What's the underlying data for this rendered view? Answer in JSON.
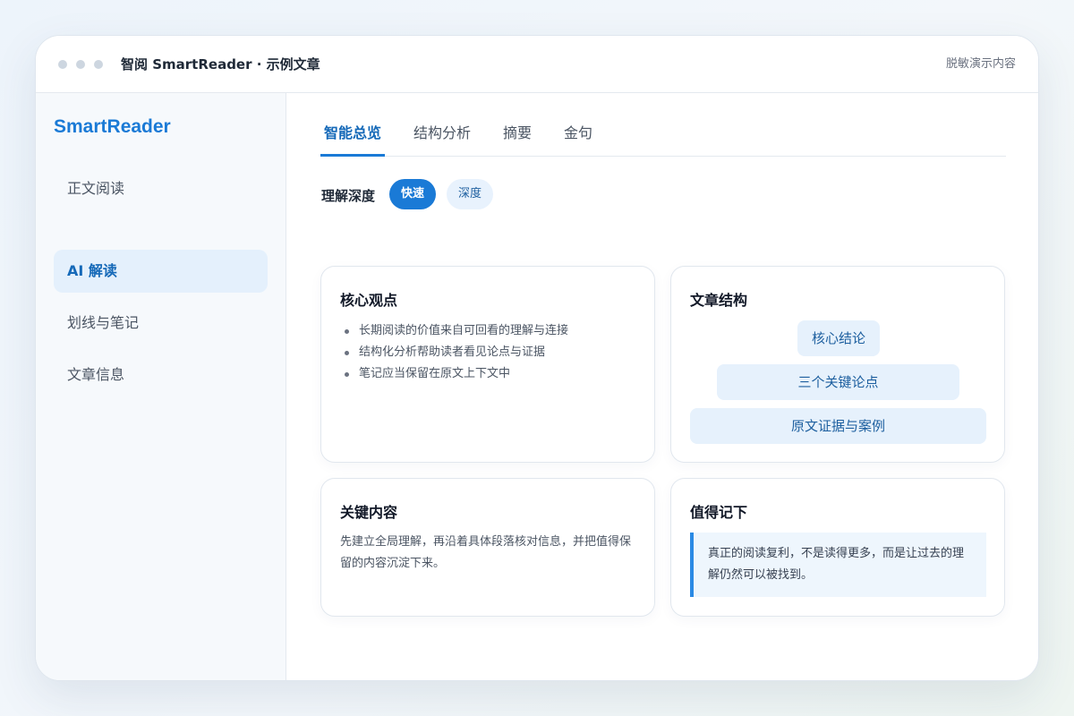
{
  "window": {
    "title": "智阅 SmartReader · 示例文章",
    "note": "脱敏演示内容"
  },
  "sidebar": {
    "brand": "SmartReader",
    "items": [
      {
        "label": "正文阅读",
        "active": false
      },
      {
        "label": "AI 解读",
        "active": true
      },
      {
        "label": "划线与笔记",
        "active": false
      },
      {
        "label": "文章信息",
        "active": false
      }
    ]
  },
  "tabs": [
    {
      "label": "智能总览",
      "active": true
    },
    {
      "label": "结构分析",
      "active": false
    },
    {
      "label": "摘要",
      "active": false
    },
    {
      "label": "金句",
      "active": false
    }
  ],
  "depth": {
    "label": "理解深度",
    "options": [
      {
        "label": "快速",
        "selected": true
      },
      {
        "label": "深度",
        "selected": false
      }
    ]
  },
  "cards": {
    "core": {
      "title": "核心观点",
      "points": [
        "长期阅读的价值来自可回看的理解与连接",
        "结构化分析帮助读者看见论点与证据",
        "笔记应当保留在原文上下文中"
      ]
    },
    "structure": {
      "title": "文章结构",
      "levels": [
        "核心结论",
        "三个关键论点",
        "原文证据与案例"
      ]
    },
    "key": {
      "title": "关键内容",
      "text": "先建立全局理解，再沿着具体段落核对信息，并把值得保留的内容沉淀下来。"
    },
    "notable": {
      "title": "值得记下",
      "quote": "真正的阅读复利，不是读得更多，而是让过去的理解仍然可以被找到。"
    }
  },
  "colors": {
    "accent": "#1a7ad6",
    "accent_soft": "#e6f1fc",
    "quote_bar": "#2b8ae4"
  }
}
